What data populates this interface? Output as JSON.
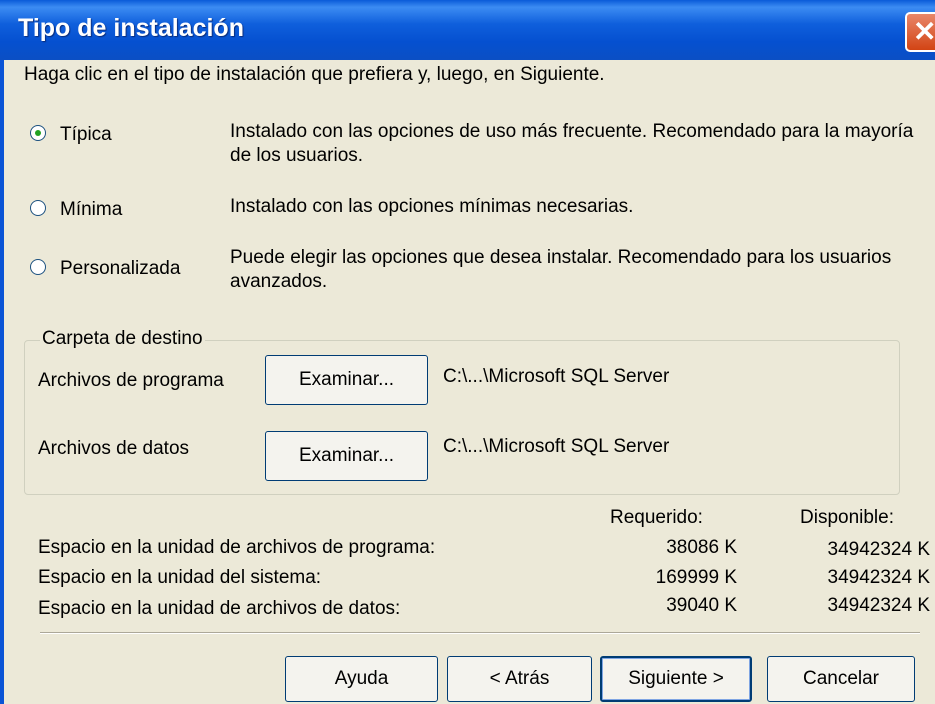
{
  "window": {
    "title": "Tipo de instalación",
    "close_glyph": "✕"
  },
  "instruction": "Haga clic en el tipo de instalación que prefiera y, luego, en Siguiente.",
  "options": [
    {
      "label": "Típica",
      "selected": true,
      "description": "Instalado con las opciones de uso más frecuente. Recomendado para la mayoría de los usuarios."
    },
    {
      "label": "Mínima",
      "selected": false,
      "description": "Instalado con las opciones mínimas necesarias."
    },
    {
      "label": "Personalizada",
      "selected": false,
      "description": "Puede elegir las opciones que desea instalar. Recomendado para los usuarios avanzados."
    }
  ],
  "destination": {
    "title": "Carpeta de destino",
    "program": {
      "label": "Archivos de programa",
      "button": "Examinar...",
      "path": "C:\\...\\Microsoft SQL Server"
    },
    "data": {
      "label": "Archivos de datos",
      "button": "Examinar...",
      "path": "C:\\...\\Microsoft SQL Server"
    }
  },
  "space": {
    "required_header": "Requerido:",
    "available_header": "Disponible:",
    "rows": [
      {
        "label": "Espacio en la unidad de archivos de programa:",
        "required": "38086 K",
        "available": "34942324 K"
      },
      {
        "label": "Espacio en la unidad del sistema:",
        "required": "169999 K",
        "available": "34942324 K"
      },
      {
        "label": "Espacio en la unidad de archivos de datos:",
        "required": "39040 K",
        "available": "34942324 K"
      }
    ]
  },
  "buttons": {
    "help": "Ayuda",
    "back": "< Atrás",
    "next": "Siguiente >",
    "cancel": "Cancelar"
  },
  "colors": {
    "titlebar": "#0A5BD8",
    "dialog_bg": "#ECE9D8",
    "close": "#D24414"
  }
}
